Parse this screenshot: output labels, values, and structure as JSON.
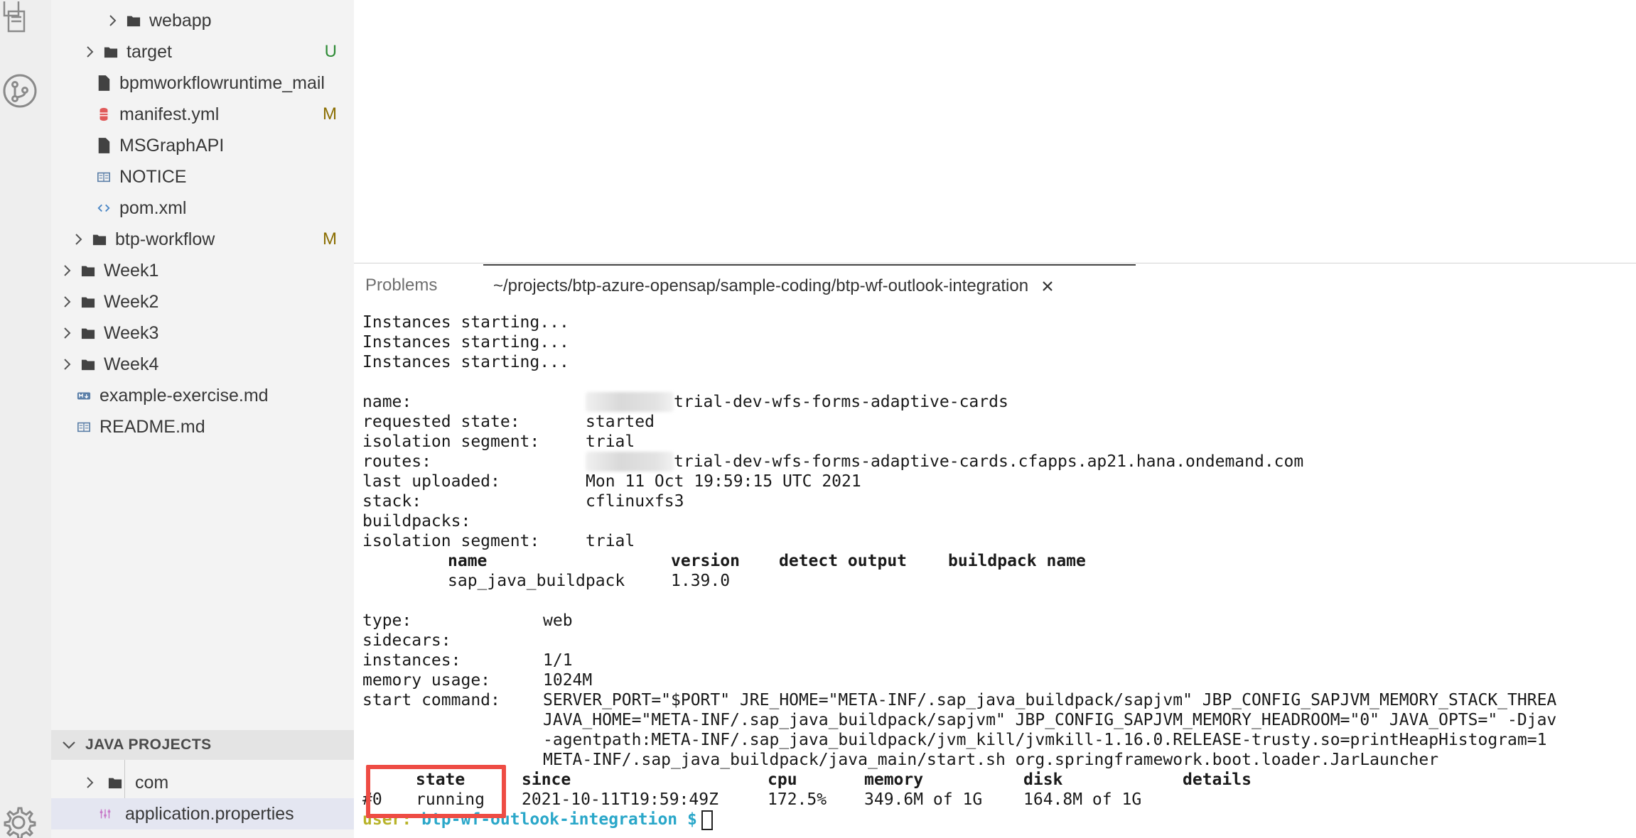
{
  "explorer": {
    "items": [
      {
        "label": "webapp",
        "kind": "folder",
        "twisty": true,
        "badge": ""
      },
      {
        "label": "target",
        "kind": "folder",
        "twisty": true,
        "badge": "U"
      },
      {
        "label": "bpmworkflowruntime_mail",
        "kind": "file",
        "twisty": false,
        "badge": ""
      },
      {
        "label": "manifest.yml",
        "kind": "yaml",
        "twisty": false,
        "badge": "M"
      },
      {
        "label": "MSGraphAPI",
        "kind": "file",
        "twisty": false,
        "badge": ""
      },
      {
        "label": "NOTICE",
        "kind": "book",
        "twisty": false,
        "badge": ""
      },
      {
        "label": "pom.xml",
        "kind": "xml",
        "twisty": false,
        "badge": ""
      },
      {
        "label": "btp-workflow",
        "kind": "folder",
        "twisty": true,
        "badge": "M"
      },
      {
        "label": "Week1",
        "kind": "folder",
        "twisty": true,
        "badge": ""
      },
      {
        "label": "Week2",
        "kind": "folder",
        "twisty": true,
        "badge": ""
      },
      {
        "label": "Week3",
        "kind": "folder",
        "twisty": true,
        "badge": ""
      },
      {
        "label": "Week4",
        "kind": "folder",
        "twisty": true,
        "badge": ""
      },
      {
        "label": "example-exercise.md",
        "kind": "markdown",
        "twisty": false,
        "badge": ""
      },
      {
        "label": "README.md",
        "kind": "book",
        "twisty": false,
        "badge": ""
      }
    ]
  },
  "java_projects": {
    "title": "JAVA PROJECTS",
    "items": [
      {
        "label": "com",
        "kind": "folder",
        "twisty": true
      },
      {
        "label": "application.properties",
        "kind": "settings",
        "twisty": false
      }
    ]
  },
  "panel": {
    "tab_problems": "Problems",
    "tab_terminal": "~/projects/btp-azure-opensap/sample-coding/btp-wf-outlook-integration"
  },
  "terminal": {
    "starting_1": "Instances starting...",
    "starting_2": "Instances starting...",
    "starting_3": "Instances starting...",
    "name_label": "name:",
    "name_value": "trial-dev-wfs-forms-adaptive-cards",
    "requested_state_label": "requested state:",
    "requested_state_value": "started",
    "isolation_label": "isolation segment:",
    "isolation_value": "trial",
    "routes_label": "routes:",
    "routes_value": "trial-dev-wfs-forms-adaptive-cards.cfapps.ap21.hana.ondemand.com",
    "last_uploaded_label": "last uploaded:",
    "last_uploaded_value": "Mon 11 Oct 19:59:15 UTC 2021",
    "stack_label": "stack:",
    "stack_value": "cflinuxfs3",
    "buildpacks_label": "buildpacks:",
    "isolation2_label": "isolation segment:",
    "isolation2_value": "trial",
    "bp_col_name": "name",
    "bp_col_version": "version",
    "bp_col_detect": "detect output",
    "bp_col_bpname": "buildpack name",
    "bp_name": "sap_java_buildpack",
    "bp_version": "1.39.0",
    "type_label": "type:",
    "type_value": "web",
    "sidecars_label": "sidecars:",
    "instances_label": "instances:",
    "instances_value": "1/1",
    "memory_usage_label": "memory usage:",
    "memory_usage_value": "1024M",
    "start_command_label": "start command:",
    "start_command_1": "SERVER_PORT=\"$PORT\" JRE_HOME=\"META-INF/.sap_java_buildpack/sapjvm\" JBP_CONFIG_SAPJVM_MEMORY_STACK_THREA",
    "start_command_2": "JAVA_HOME=\"META-INF/.sap_java_buildpack/sapjvm\" JBP_CONFIG_SAPJVM_MEMORY_HEADROOM=\"0\" JAVA_OPTS=\" -Djav",
    "start_command_3": "-agentpath:META-INF/.sap_java_buildpack/jvm_kill/jvmkill-1.16.0.RELEASE-trusty.so=printHeapHistogram=1",
    "start_command_4": "META-INF/.sap_java_buildpack/java_main/start.sh org.springframework.boot.loader.JarLauncher",
    "col_state": "state",
    "col_since": "since",
    "col_cpu": "cpu",
    "col_memory": "memory",
    "col_disk": "disk",
    "col_details": "details",
    "row_index": "#0",
    "row_state": "running",
    "row_since": "2021-10-11T19:59:49Z",
    "row_cpu": "172.5%",
    "row_memory": "349.6M of 1G",
    "row_disk": "164.8M of 1G",
    "prompt_user": "user:",
    "prompt_dir": "btp-wf-outlook-integration",
    "prompt_symbol": "$"
  }
}
